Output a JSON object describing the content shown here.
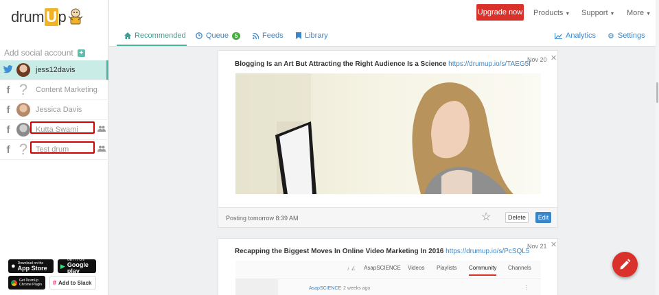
{
  "brand": {
    "name_pre": "drum",
    "name_u": "U",
    "name_post": "p"
  },
  "sidebar": {
    "add_label": "Add social account",
    "accounts": [
      {
        "network": "twitter",
        "name": "jess12davis",
        "avatar": "photo",
        "active": true
      },
      {
        "network": "facebook",
        "name": "Content Marketing",
        "avatar": "placeholder"
      },
      {
        "network": "facebook",
        "name": "Jessica Davis",
        "avatar": "photo"
      },
      {
        "network": "facebook",
        "name": "Kutta Swami",
        "avatar": "photo",
        "group": true,
        "highlighted": true
      },
      {
        "network": "facebook",
        "name": "Test drum",
        "avatar": "placeholder",
        "group": true,
        "highlighted": true
      }
    ],
    "stores": {
      "appstore": {
        "small": "Download on the",
        "big": "App Store"
      },
      "googleplay": {
        "small": "GET IT ON",
        "big": "Google play"
      },
      "chrome": {
        "small": "Get DrumUp",
        "big": "Chrome Plugin"
      },
      "slack": {
        "label": "Add to Slack"
      }
    }
  },
  "topbar": {
    "upgrade": "Upgrade now",
    "menus": [
      "Products",
      "Support",
      "More"
    ],
    "tabs": {
      "recommended": "Recommended",
      "queue": "Queue",
      "queue_count": "5",
      "feeds": "Feeds",
      "library": "Library"
    },
    "right": {
      "analytics": "Analytics",
      "settings": "Settings"
    }
  },
  "posts": [
    {
      "title": "Blogging Is an Art But Attracting the Right Audience Is a Science",
      "link": "https://drumup.io/s/TAEG5f",
      "date": "Nov 20",
      "status": "Posting tomorrow 8:39 AM",
      "delete": "Delete",
      "edit": "Edit"
    },
    {
      "title": "Recapping the Biggest Moves In Online Video Marketing In 2016",
      "link": "https://drumup.io/s/PcSQL5",
      "date": "Nov 21",
      "preview": {
        "channel": "AsapSCIENCE",
        "tabs": [
          "AsapSCIENCE",
          "Videos",
          "Playlists",
          "Community",
          "Channels"
        ],
        "active_tab": "Community",
        "post_author": "AsapSCIENCE",
        "post_time": "2 weeks ago"
      }
    }
  ],
  "colors": {
    "teal": "#46b1a2",
    "red": "#d9322b",
    "blue": "#3a86c8",
    "green": "#4aab45"
  }
}
